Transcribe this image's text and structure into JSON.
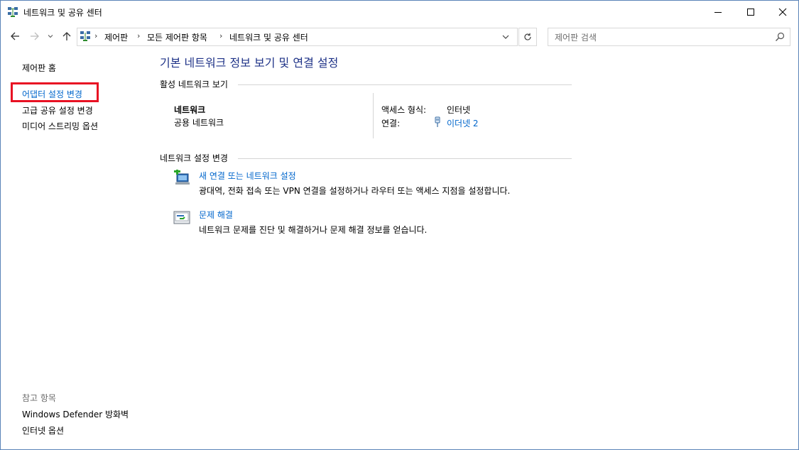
{
  "window": {
    "title": "네트워크 및 공유 센터"
  },
  "address": {
    "crumbs": [
      "제어판",
      "모든 제어판 항목",
      "네트워크 및 공유 센터"
    ],
    "search_placeholder": "제어판 검색"
  },
  "sidebar": {
    "home": "제어판 홈",
    "links": [
      "어댑터 설정 변경",
      "고급 공유 설정 변경",
      "미디어 스트리밍 옵션"
    ],
    "see_also_heading": "참고 항목",
    "see_also": [
      "Windows Defender 방화벽",
      "인터넷 옵션"
    ]
  },
  "main": {
    "title": "기본 네트워크 정보 보기 및 연결 설정",
    "active_section": "활성 네트워크 보기",
    "network_name": "네트워크",
    "network_type": "공용 네트워크",
    "access_label": "액세스 형식:",
    "access_value": "인터넷",
    "connection_label": "연결:",
    "connection_value": "이더넷 2",
    "change_section": "네트워크 설정 변경",
    "tasks": [
      {
        "title": "새 연결 또는 네트워크 설정",
        "desc": "광대역, 전화 접속 또는 VPN 연결을 설정하거나 라우터 또는 액세스 지점을 설정합니다.",
        "icon": "new-connection-icon"
      },
      {
        "title": "문제 해결",
        "desc": "네트워크 문제를 진단 및 해결하거나 문제 해결 정보를 얻습니다.",
        "icon": "troubleshoot-icon"
      }
    ]
  },
  "colors": {
    "link": "#0066cc",
    "title": "#1e3287",
    "highlight": "#e81123"
  }
}
